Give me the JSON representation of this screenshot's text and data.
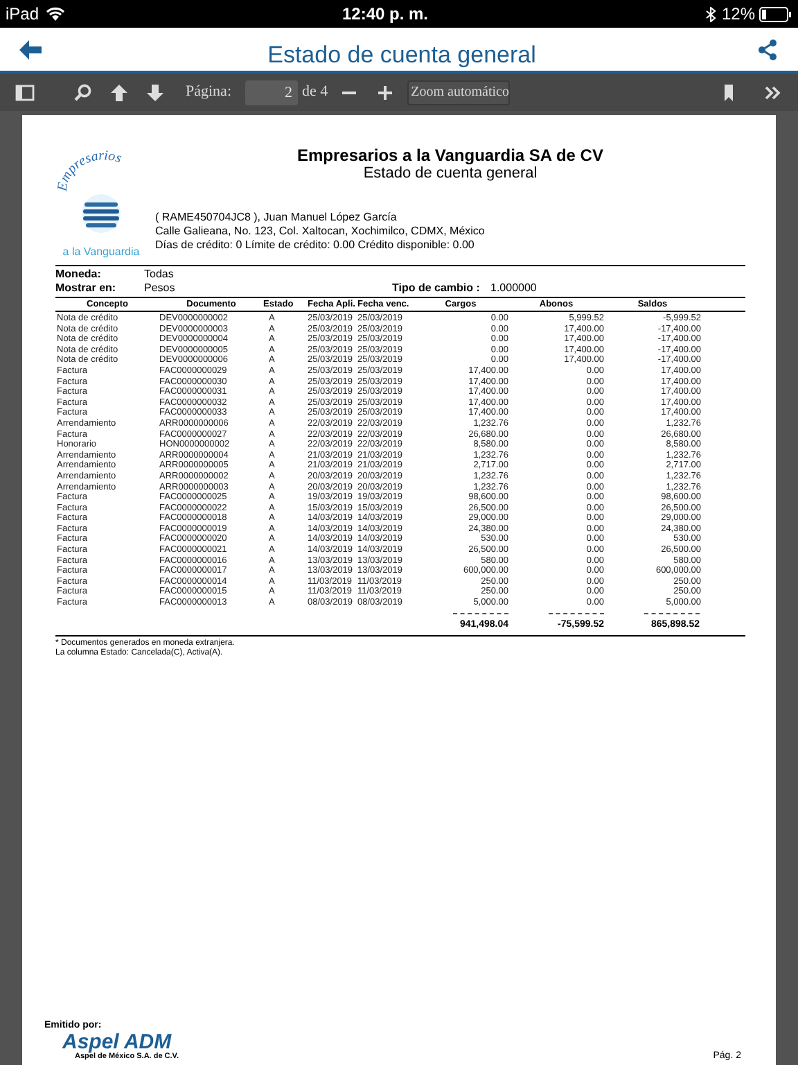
{
  "status_bar": {
    "device": "iPad",
    "time": "12:40 p. m.",
    "battery": "12%"
  },
  "nav_bar": {
    "title": "Estado de cuenta general"
  },
  "toolbar": {
    "page_label": "Página:",
    "page_value": "2",
    "page_total": "de 4",
    "zoom": "Zoom automático"
  },
  "document": {
    "company": "Empresarios a la Vanguardia SA de CV",
    "report_title": "Estado de cuenta general",
    "logo": {
      "arc_text": "Empresarios",
      "tagline": "a la Vanguardia"
    },
    "client_lines": [
      "( RAME450704JC8 ), Juan Manuel López García",
      "Calle Galieana, No. 123, Col. Xaltocan, Xochimilco, CDMX, México",
      "Días de crédito: 0 Límite de crédito: 0.00 Crédito disponible: 0.00"
    ],
    "currency_label": "Moneda:",
    "currency": "Todas",
    "show_in_label": "Mostrar en:",
    "show_in": "Pesos",
    "rate_label": "Tipo de cambio :",
    "rate": "1.000000",
    "table": {
      "columns": [
        "Concepto",
        "Documento",
        "Estado",
        "Fecha Apli.",
        "Fecha venc.",
        "Cargos",
        "Abonos",
        "Saldos"
      ],
      "rows": [
        [
          "Nota de crédito",
          "DEV0000000002",
          "A",
          "25/03/2019",
          "25/03/2019",
          "0.00",
          "5,999.52",
          "-5,999.52"
        ],
        [
          "Nota de crédito",
          "DEV0000000003",
          "A",
          "25/03/2019",
          "25/03/2019",
          "0.00",
          "17,400.00",
          "-17,400.00"
        ],
        [
          "Nota de crédito",
          "DEV0000000004",
          "A",
          "25/03/2019",
          "25/03/2019",
          "0.00",
          "17,400.00",
          "-17,400.00"
        ],
        [
          "Nota de crédito",
          "DEV0000000005",
          "A",
          "25/03/2019",
          "25/03/2019",
          "0.00",
          "17,400.00",
          "-17,400.00"
        ],
        [
          "Nota de crédito",
          "DEV0000000006",
          "A",
          "25/03/2019",
          "25/03/2019",
          "0.00",
          "17,400.00",
          "-17,400.00"
        ],
        [
          "Factura",
          "FAC0000000029",
          "A",
          "25/03/2019",
          "25/03/2019",
          "17,400.00",
          "0.00",
          "17,400.00"
        ],
        [
          "Factura",
          "FAC0000000030",
          "A",
          "25/03/2019",
          "25/03/2019",
          "17,400.00",
          "0.00",
          "17,400.00"
        ],
        [
          "Factura",
          "FAC0000000031",
          "A",
          "25/03/2019",
          "25/03/2019",
          "17,400.00",
          "0.00",
          "17,400.00"
        ],
        [
          "Factura",
          "FAC0000000032",
          "A",
          "25/03/2019",
          "25/03/2019",
          "17,400.00",
          "0.00",
          "17,400.00"
        ],
        [
          "Factura",
          "FAC0000000033",
          "A",
          "25/03/2019",
          "25/03/2019",
          "17,400.00",
          "0.00",
          "17,400.00"
        ],
        [
          "Arrendamiento",
          "ARR0000000006",
          "A",
          "22/03/2019",
          "22/03/2019",
          "1,232.76",
          "0.00",
          "1,232.76"
        ],
        [
          "Factura",
          "FAC0000000027",
          "A",
          "22/03/2019",
          "22/03/2019",
          "26,680.00",
          "0.00",
          "26,680.00"
        ],
        [
          "Honorario",
          "HON0000000002",
          "A",
          "22/03/2019",
          "22/03/2019",
          "8,580.00",
          "0.00",
          "8,580.00"
        ],
        [
          "Arrendamiento",
          "ARR0000000004",
          "A",
          "21/03/2019",
          "21/03/2019",
          "1,232.76",
          "0.00",
          "1,232.76"
        ],
        [
          "Arrendamiento",
          "ARR0000000005",
          "A",
          "21/03/2019",
          "21/03/2019",
          "2,717.00",
          "0.00",
          "2,717.00"
        ],
        [
          "Arrendamiento",
          "ARR0000000002",
          "A",
          "20/03/2019",
          "20/03/2019",
          "1,232.76",
          "0.00",
          "1,232.76"
        ],
        [
          "Arrendamiento",
          "ARR0000000003",
          "A",
          "20/03/2019",
          "20/03/2019",
          "1,232.76",
          "0.00",
          "1,232.76"
        ],
        [
          "Factura",
          "FAC0000000025",
          "A",
          "19/03/2019",
          "19/03/2019",
          "98,600.00",
          "0.00",
          "98,600.00"
        ],
        [
          "Factura",
          "FAC0000000022",
          "A",
          "15/03/2019",
          "15/03/2019",
          "26,500.00",
          "0.00",
          "26,500.00"
        ],
        [
          "Factura",
          "FAC0000000018",
          "A",
          "14/03/2019",
          "14/03/2019",
          "29,000.00",
          "0.00",
          "29,000.00"
        ],
        [
          "Factura",
          "FAC0000000019",
          "A",
          "14/03/2019",
          "14/03/2019",
          "24,380.00",
          "0.00",
          "24,380.00"
        ],
        [
          "Factura",
          "FAC0000000020",
          "A",
          "14/03/2019",
          "14/03/2019",
          "530.00",
          "0.00",
          "530.00"
        ],
        [
          "Factura",
          "FAC0000000021",
          "A",
          "14/03/2019",
          "14/03/2019",
          "26,500.00",
          "0.00",
          "26,500.00"
        ],
        [
          "Factura",
          "FAC0000000016",
          "A",
          "13/03/2019",
          "13/03/2019",
          "580.00",
          "0.00",
          "580.00"
        ],
        [
          "Factura",
          "FAC0000000017",
          "A",
          "13/03/2019",
          "13/03/2019",
          "600,000.00",
          "0.00",
          "600,000.00"
        ],
        [
          "Factura",
          "FAC0000000014",
          "A",
          "11/03/2019",
          "11/03/2019",
          "250.00",
          "0.00",
          "250.00"
        ],
        [
          "Factura",
          "FAC0000000015",
          "A",
          "11/03/2019",
          "11/03/2019",
          "250.00",
          "0.00",
          "250.00"
        ],
        [
          "Factura",
          "FAC0000000013",
          "A",
          "08/03/2019",
          "08/03/2019",
          "5,000.00",
          "0.00",
          "5,000.00"
        ]
      ],
      "totals": [
        "941,498.04",
        "-75,599.52",
        "865,898.52"
      ]
    },
    "notes": [
      "* Documentos generados en moneda extranjera.",
      "La columna Estado: Cancelada(C), Activa(A)."
    ],
    "footer": {
      "issued_by": "Emitido por:",
      "brand": "Aspel ADM",
      "brand_company": "Aspel de México S.A. de C.V.",
      "page": "Pág. 2"
    }
  }
}
